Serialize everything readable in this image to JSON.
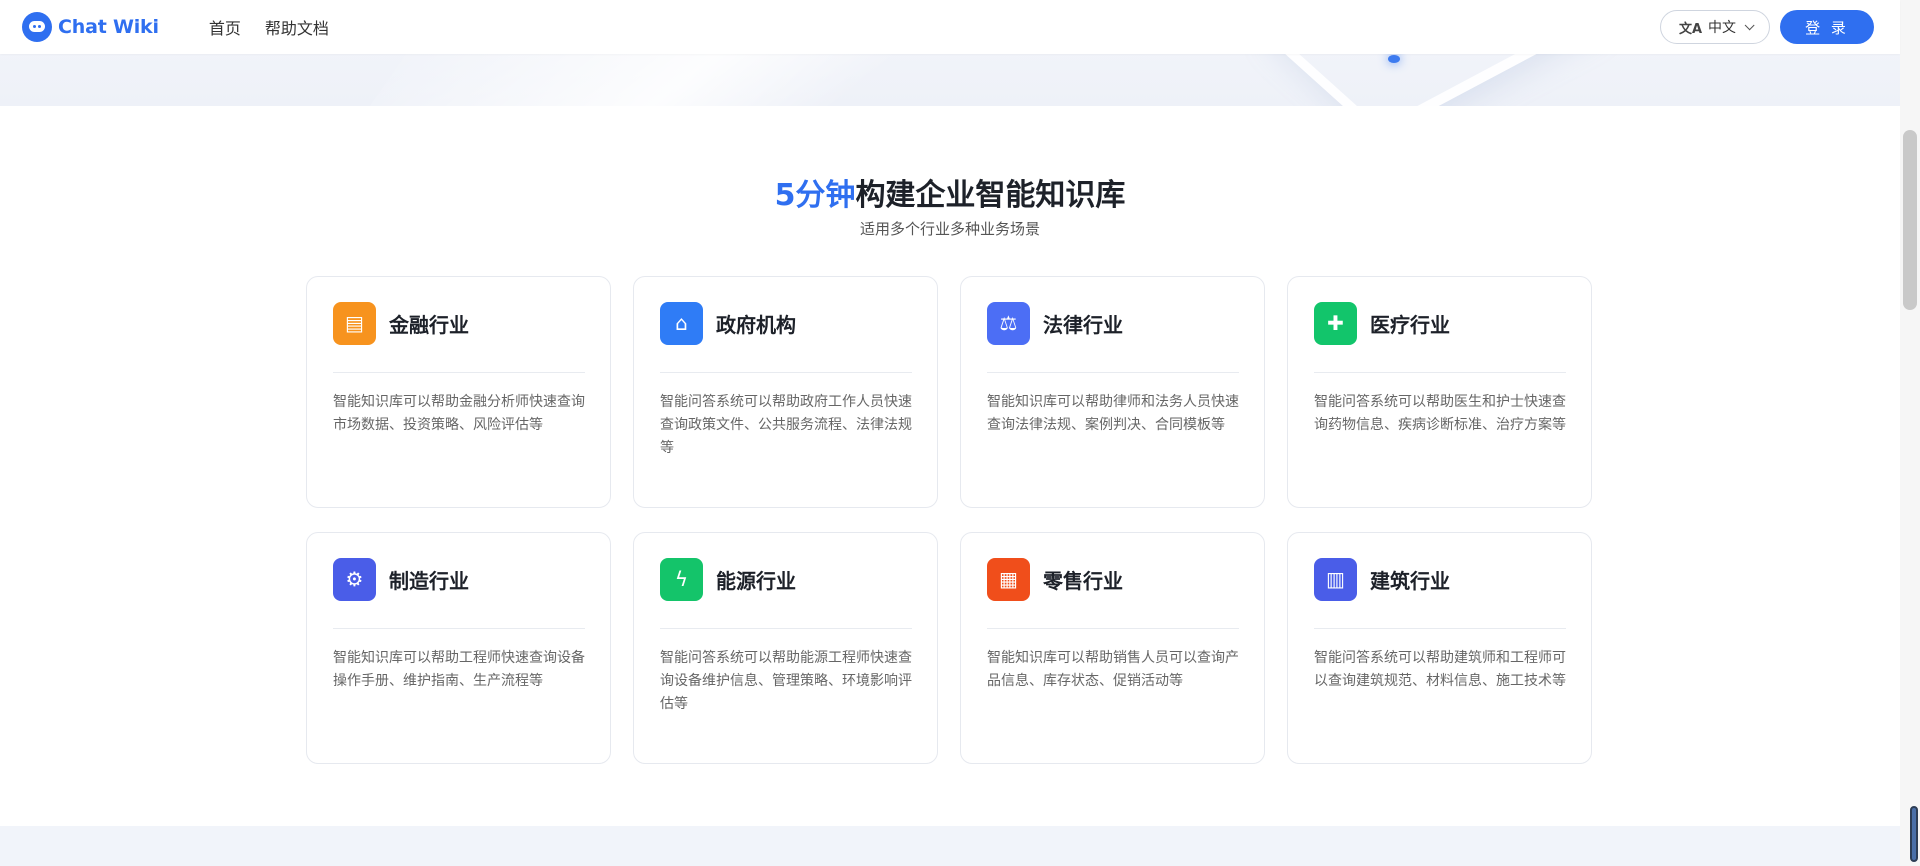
{
  "header": {
    "logo_text": "Chat Wiki",
    "nav": [
      "首页",
      "帮助文档"
    ],
    "language": "中文",
    "login_label": "登 录"
  },
  "section": {
    "title_highlight": "5分钟",
    "title_rest": "构建企业智能知识库",
    "subtitle": "适用多个行业多种业务场景"
  },
  "cards": [
    {
      "title": "金融行业",
      "icon": "coins-icon",
      "color": "#f7931e",
      "glyph": "▤",
      "desc": "智能知识库可以帮助金融分析师快速查询市场数据、投资策略、风险评估等"
    },
    {
      "title": "政府机构",
      "icon": "government-building-icon",
      "color": "#2f7cf6",
      "glyph": "⌂",
      "desc": "智能问答系统可以帮助政府工作人员快速查询政策文件、公共服务流程、法律法规等"
    },
    {
      "title": "法律行业",
      "icon": "gavel-icon",
      "color": "#4c6ef5",
      "glyph": "⚖",
      "desc": "智能知识库可以帮助律师和法务人员快速查询法律法规、案例判决、合同模板等"
    },
    {
      "title": "医疗行业",
      "icon": "medical-kit-icon",
      "color": "#12c56b",
      "glyph": "✚",
      "desc": "智能问答系统可以帮助医生和护士快速查询药物信息、疾病诊断标准、治疗方案等"
    },
    {
      "title": "制造行业",
      "icon": "robot-arm-icon",
      "color": "#4a5de8",
      "glyph": "⚙",
      "desc": "智能知识库可以帮助工程师快速查询设备操作手册、维护指南、生产流程等"
    },
    {
      "title": "能源行业",
      "icon": "energy-bolt-icon",
      "color": "#14c46a",
      "glyph": "ϟ",
      "desc": "智能问答系统可以帮助能源工程师快速查询设备维护信息、管理策略、环境影响评估等"
    },
    {
      "title": "零售行业",
      "icon": "store-icon",
      "color": "#f04e1b",
      "glyph": "▦",
      "desc": "智能知识库可以帮助销售人员可以查询产品信息、库存状态、促销活动等"
    },
    {
      "title": "建筑行业",
      "icon": "building-icon",
      "color": "#4a5de8",
      "glyph": "▥",
      "desc": "智能问答系统可以帮助建筑师和工程师可以查询建筑规范、材料信息、施工技术等"
    }
  ]
}
